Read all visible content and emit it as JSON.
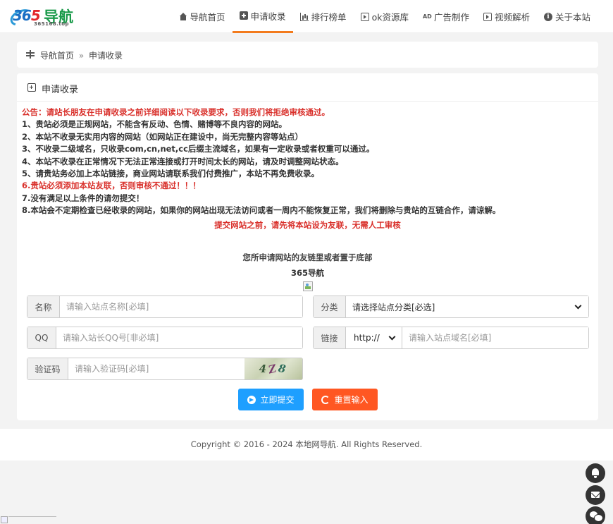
{
  "logo": {
    "brand_num": "365",
    "brand_cn": "导航",
    "domain": "365168.top"
  },
  "nav": [
    {
      "label": "导航首页",
      "icon": "home-icon"
    },
    {
      "label": "申请收录",
      "icon": "plus-square-icon",
      "active": true
    },
    {
      "label": "排行榜单",
      "icon": "bar-chart-icon"
    },
    {
      "label": "ok资源库",
      "icon": "play-square-icon"
    },
    {
      "label": "广告制作",
      "icon": "ad-icon",
      "icon_text": "AD"
    },
    {
      "label": "视频解析",
      "icon": "play-square-icon"
    },
    {
      "label": "关于本站",
      "icon": "info-circle-icon",
      "icon_text": "i"
    }
  ],
  "breadcrumb": {
    "home": "导航首页",
    "separator": "»",
    "current": "申请收录"
  },
  "card": {
    "title": "申请收录"
  },
  "notice": {
    "heading": "公告：请站长朋友在申请收录之前详细阅读以下收录要求，否则我们将拒绝审核通过。",
    "lines": [
      "1、贵站必须是正规网站，不能含有反动、色情、赌博等不良内容的网站。",
      "2、本站不收录无实用内容的网站（如网站正在建设中，尚无完整内容等站点）",
      "3、不收录二级域名，只收录com,cn,net,cc后缀主流域名，如果有一定收录或者权重可以通过。",
      "4、本站不收录在正常情况下无法正常连接或打开时间太长的网站，请及时调整网站状态。",
      "5、请贵站务必加上本站链接，商业网站请联系我们付费推广，本站不再免费收录。"
    ],
    "warning": "6.贵站必须添加本站友联，否则审核不通过！！！",
    "line7": "7.没有满足以上条件的请勿提交！",
    "line8": "8.本站会不定期检查已经收录的网站，如果你的网站出现无法访问或者一周内不能恢复正常，我们将删除与贵站的互链合作，请谅解。",
    "center_red": "提交网站之前，请先将本站设为友联，无需人工审核",
    "center_note": "您所申请网站的友链里或者置于底部",
    "site_name": "365导航"
  },
  "form": {
    "name_label": "名称",
    "name_placeholder": "请输入站点名称[必填]",
    "category_label": "分类",
    "category_selected": "请选择站点分类[必选]",
    "qq_label": "QQ",
    "qq_placeholder": "请输入站长QQ号[非必填]",
    "link_label": "链接",
    "protocol_selected": "http://",
    "link_placeholder": "请输入站点域名[必填]",
    "captcha_label": "验证码",
    "captcha_placeholder": "请输入验证码[必填]",
    "captcha_text": [
      "4",
      "Z",
      "8"
    ],
    "submit_label": "立即提交",
    "reset_label": "重置输入"
  },
  "footer": {
    "text": "Copyright © 2016 - 2024 本地网导航. All Rights Reserved."
  },
  "colors": {
    "accent": "#f37b1d",
    "red": "#d9302b",
    "submit": "#1e9fff",
    "reset": "#ff5722"
  }
}
